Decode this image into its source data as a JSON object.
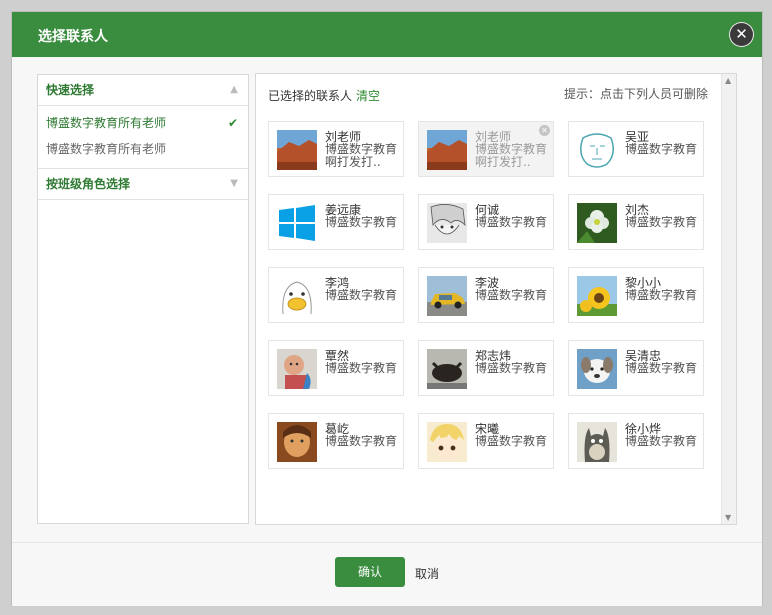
{
  "dialog": {
    "title": "选择联系人"
  },
  "left": {
    "quick_select": "快速选择",
    "items": [
      {
        "label": "博盛数字教育所有老师",
        "checked": true
      },
      {
        "label": "博盛数字教育所有老师",
        "checked": false
      }
    ],
    "by_class_role": "按班级角色选择"
  },
  "right": {
    "selected_label": "已选择的联系人",
    "clear_label": "清空",
    "hint": "提示：点击下列人员可删除",
    "contacts": [
      {
        "name": "刘老师",
        "dept": "博盛数字教育啊打发打..",
        "avatar": "desert-rock-avatar"
      },
      {
        "name": "刘老师",
        "dept": "博盛数字教育啊打发打..",
        "avatar": "desert-rock-avatar",
        "selected": true
      },
      {
        "name": "吴亚",
        "dept": "博盛数字教育",
        "avatar": "sketch-face-avatar"
      },
      {
        "name": "姜远康",
        "dept": "博盛数字教育",
        "avatar": "windows-logo-avatar"
      },
      {
        "name": "何诚",
        "dept": "博盛数字教育",
        "avatar": "anime-boy-avatar"
      },
      {
        "name": "刘杰",
        "dept": "博盛数字教育",
        "avatar": "flower-avatar"
      },
      {
        "name": "李鸿",
        "dept": "博盛数字教育",
        "avatar": "cartoon-duck-avatar"
      },
      {
        "name": "李波",
        "dept": "博盛数字教育",
        "avatar": "yellow-car-avatar"
      },
      {
        "name": "黎小小",
        "dept": "博盛数字教育",
        "avatar": "sunflower-avatar"
      },
      {
        "name": "覃然",
        "dept": "博盛数字教育",
        "avatar": "baby-avatar"
      },
      {
        "name": "郑志炜",
        "dept": "博盛数字教育",
        "avatar": "bull-avatar"
      },
      {
        "name": "吴清忠",
        "dept": "博盛数字教育",
        "avatar": "puppy-avatar"
      },
      {
        "name": "葛屹",
        "dept": "博盛数字教育",
        "avatar": "warm-portrait-avatar"
      },
      {
        "name": "宋曦",
        "dept": "博盛数字教育",
        "avatar": "blonde-anime-avatar"
      },
      {
        "name": "徐小烨",
        "dept": "博盛数字教育",
        "avatar": "totoro-avatar"
      }
    ]
  },
  "footer": {
    "confirm": "确认",
    "cancel": "取消"
  },
  "colors": {
    "brand": "#3a8c3f",
    "link": "#2f8a33"
  }
}
